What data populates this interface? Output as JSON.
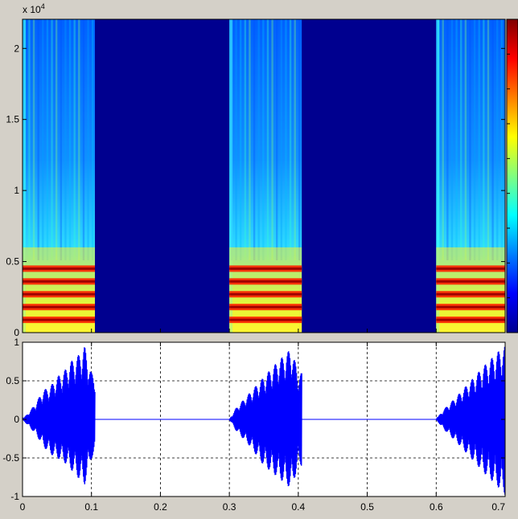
{
  "chart_data": [
    {
      "type": "heatmap",
      "title": "",
      "xlabel": "",
      "ylabel": "",
      "y_exponent_label": "x 10",
      "y_exponent_power": "4",
      "ylim": [
        0,
        22050
      ],
      "xlim": [
        0,
        0.7
      ],
      "y_ticks": [
        {
          "value": 0,
          "label": "0"
        },
        {
          "value": 5000,
          "label": "0.5"
        },
        {
          "value": 10000,
          "label": "1"
        },
        {
          "value": 15000,
          "label": "1.5"
        },
        {
          "value": 20000,
          "label": "2"
        }
      ],
      "colormap": "jet",
      "colorbar": "right",
      "grid": false,
      "active_segments": [
        {
          "x_start": 0.0,
          "x_end": 0.105
        },
        {
          "x_start": 0.3,
          "x_end": 0.405
        },
        {
          "x_start": 0.6,
          "x_end": 0.705
        }
      ],
      "harmonic_bands_y": [
        900,
        1800,
        2700,
        3600,
        4500
      ]
    },
    {
      "type": "line",
      "title": "",
      "xlabel": "",
      "ylabel": "",
      "xlim": [
        0,
        0.7
      ],
      "ylim": [
        -1,
        1
      ],
      "grid": true,
      "line_color": "#0000ff",
      "x_ticks": [
        {
          "value": 0,
          "label": "0"
        },
        {
          "value": 0.1,
          "label": "0.1"
        },
        {
          "value": 0.2,
          "label": "0.2"
        },
        {
          "value": 0.3,
          "label": "0.3"
        },
        {
          "value": 0.4,
          "label": "0.4"
        },
        {
          "value": 0.5,
          "label": "0.5"
        },
        {
          "value": 0.6,
          "label": "0.6"
        },
        {
          "value": 0.7,
          "label": "0.7"
        }
      ],
      "y_ticks": [
        {
          "value": -1,
          "label": "-1"
        },
        {
          "value": -0.5,
          "label": "-0.5"
        },
        {
          "value": 0,
          "label": "0"
        },
        {
          "value": 0.5,
          "label": "0.5"
        },
        {
          "value": 1,
          "label": "1"
        }
      ],
      "envelope_peaks": [
        {
          "x": 0.01,
          "top": 0.1,
          "bottom": -0.1
        },
        {
          "x": 0.02,
          "top": 0.22,
          "bottom": -0.2
        },
        {
          "x": 0.03,
          "top": 0.38,
          "bottom": -0.35
        },
        {
          "x": 0.04,
          "top": 0.42,
          "bottom": -0.45
        },
        {
          "x": 0.05,
          "top": 0.55,
          "bottom": -0.5
        },
        {
          "x": 0.06,
          "top": 0.62,
          "bottom": -0.55
        },
        {
          "x": 0.07,
          "top": 0.75,
          "bottom": -0.65
        },
        {
          "x": 0.08,
          "top": 0.82,
          "bottom": -0.75
        },
        {
          "x": 0.09,
          "top": 0.95,
          "bottom": -0.85
        },
        {
          "x": 0.1,
          "top": 0.6,
          "bottom": -0.5
        },
        {
          "x": 0.31,
          "top": 0.15,
          "bottom": -0.15
        },
        {
          "x": 0.33,
          "top": 0.35,
          "bottom": -0.35
        },
        {
          "x": 0.35,
          "top": 0.55,
          "bottom": -0.6
        },
        {
          "x": 0.37,
          "top": 0.75,
          "bottom": -0.75
        },
        {
          "x": 0.39,
          "top": 0.92,
          "bottom": -0.9
        },
        {
          "x": 0.4,
          "top": 0.6,
          "bottom": -0.6
        },
        {
          "x": 0.61,
          "top": 0.12,
          "bottom": -0.12
        },
        {
          "x": 0.63,
          "top": 0.3,
          "bottom": -0.3
        },
        {
          "x": 0.65,
          "top": 0.5,
          "bottom": -0.5
        },
        {
          "x": 0.67,
          "top": 0.7,
          "bottom": -0.7
        },
        {
          "x": 0.69,
          "top": 0.88,
          "bottom": -0.88
        },
        {
          "x": 0.7,
          "top": 0.95,
          "bottom": -0.98
        }
      ]
    }
  ]
}
